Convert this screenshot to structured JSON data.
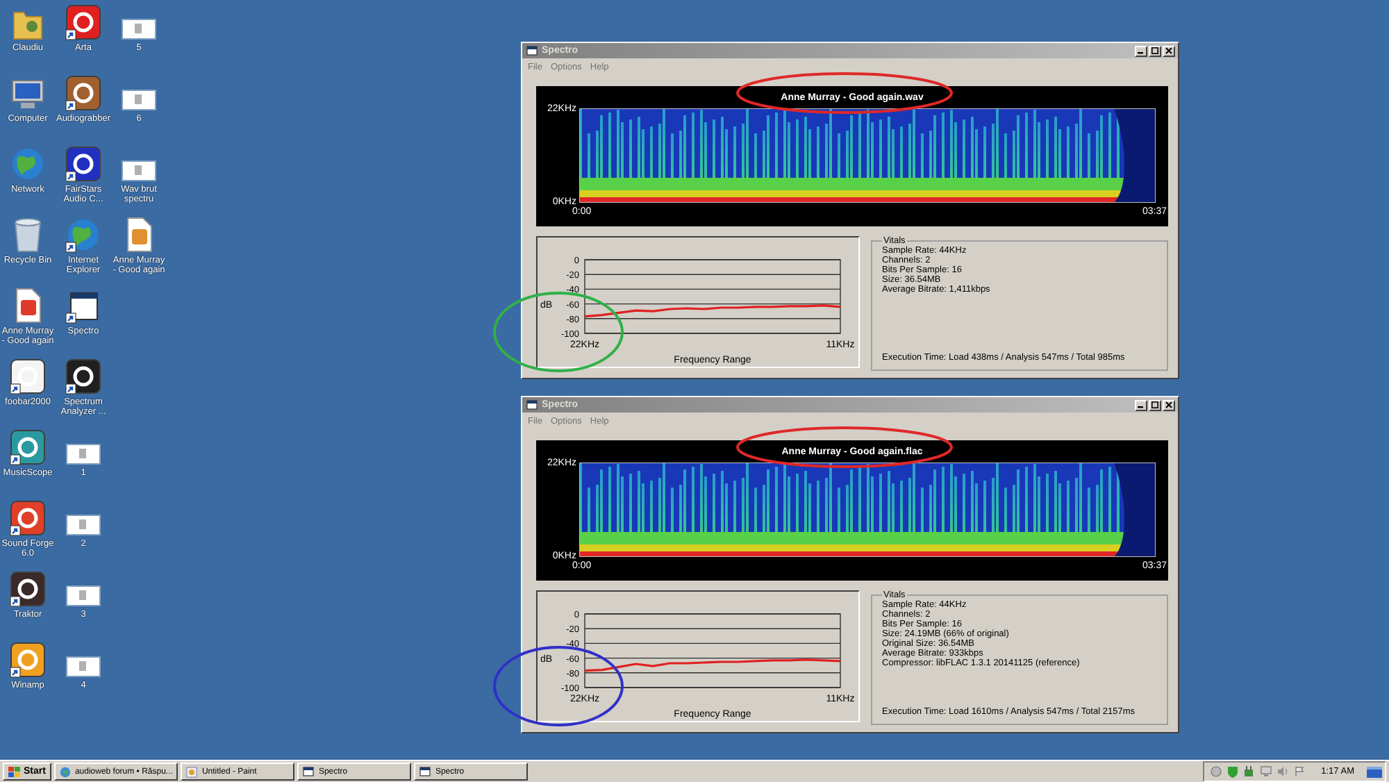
{
  "desktop_icons": [
    {
      "label": "Claudiu",
      "kind": "folder",
      "shortcut": false
    },
    {
      "label": "Computer",
      "kind": "computer",
      "shortcut": false
    },
    {
      "label": "Network",
      "kind": "globe",
      "shortcut": false
    },
    {
      "label": "Recycle Bin",
      "kind": "bin",
      "shortcut": false
    },
    {
      "label": "Anne Murray - Good again",
      "kind": "document",
      "color": "#e03a2a",
      "shortcut": false
    },
    {
      "label": "foobar2000",
      "kind": "app",
      "color": "#f4f4f4",
      "shortcut": true
    },
    {
      "label": "MusicScope",
      "kind": "app",
      "color": "#2a9aa0",
      "shortcut": true
    },
    {
      "label": "Sound Forge 6.0",
      "kind": "app",
      "color": "#e0402a",
      "shortcut": true
    },
    {
      "label": "Traktor",
      "kind": "app",
      "color": "#3a2a2a",
      "shortcut": true
    },
    {
      "label": "Winamp",
      "kind": "app",
      "color": "#f0a020",
      "shortcut": true
    },
    {
      "label": "Arta",
      "kind": "app",
      "color": "#e02020",
      "shortcut": true
    },
    {
      "label": "Audiograbber",
      "kind": "app",
      "color": "#a06030",
      "shortcut": true
    },
    {
      "label": "FairStars Audio C...",
      "kind": "app",
      "color": "#2030c0",
      "shortcut": true
    },
    {
      "label": "Internet Explorer",
      "kind": "globe",
      "shortcut": true
    },
    {
      "label": "Spectro",
      "kind": "window",
      "shortcut": true
    },
    {
      "label": "Spectrum Analyzer ...",
      "kind": "app",
      "color": "#202020",
      "shortcut": true
    },
    {
      "label": "1",
      "kind": "thumbnail",
      "shortcut": false
    },
    {
      "label": "2",
      "kind": "thumbnail",
      "shortcut": false
    },
    {
      "label": "3",
      "kind": "thumbnail",
      "shortcut": false
    },
    {
      "label": "4",
      "kind": "thumbnail",
      "shortcut": false
    },
    {
      "label": "5",
      "kind": "thumbnail",
      "shortcut": false
    },
    {
      "label": "6",
      "kind": "thumbnail",
      "shortcut": false
    },
    {
      "label": "Wav brut spectru",
      "kind": "thumbnail",
      "shortcut": false
    },
    {
      "label": "Anne Murray - Good again",
      "kind": "document",
      "color": "#e09030",
      "shortcut": false
    }
  ],
  "windows": [
    {
      "title": "Spectro",
      "menu": [
        "File",
        "Options",
        "Help"
      ],
      "spectrogram": {
        "title": "Anne Murray - Good again.wav",
        "y_top": "22KHz",
        "y_bottom": "0KHz",
        "start": "0:00",
        "end": "03:37"
      },
      "title_highlight": {
        "color": "#e02828"
      },
      "graph_highlight": {
        "color": "#30b048"
      },
      "chart_data": {
        "type": "line",
        "xlabel": "Frequency Range",
        "ylabel": "dB",
        "categories": [
          "22KHz",
          null,
          null,
          null,
          null,
          null,
          null,
          null,
          null,
          null,
          null,
          null,
          null,
          null,
          null,
          "11KHz"
        ],
        "series": [
          {
            "color": "#e02020",
            "values": [
              -77,
              -75,
              -72,
              -69,
              -70,
              -67,
              -66,
              -67,
              -65,
              -65,
              -64,
              -64,
              -63,
              -63,
              -62,
              -64
            ]
          }
        ],
        "grid": true,
        "ylim": [
          -100,
          0
        ],
        "yticks": [
          0,
          -20,
          -40,
          -60,
          -80,
          -100
        ]
      },
      "vitals": {
        "legend": "Vitals",
        "lines": [
          "Sample Rate: 44KHz",
          "Channels: 2",
          "Bits Per Sample: 16",
          "Size: 36.54MB",
          "Average Bitrate: 1,411kbps"
        ],
        "execution": "Execution Time: Load 438ms / Analysis 547ms / Total 985ms"
      }
    },
    {
      "title": "Spectro",
      "menu": [
        "File",
        "Options",
        "Help"
      ],
      "spectrogram": {
        "title": "Anne Murray - Good again.flac",
        "y_top": "22KHz",
        "y_bottom": "0KHz",
        "start": "0:00",
        "end": "03:37"
      },
      "title_highlight": {
        "color": "#e02828"
      },
      "graph_highlight": {
        "color": "#3030c8"
      },
      "chart_data": {
        "type": "line",
        "xlabel": "Frequency Range",
        "ylabel": "dB",
        "categories": [
          "22KHz",
          null,
          null,
          null,
          null,
          null,
          null,
          null,
          null,
          null,
          null,
          null,
          null,
          null,
          null,
          "11KHz"
        ],
        "series": [
          {
            "color": "#e02020",
            "values": [
              -77,
              -76,
              -72,
              -68,
              -71,
              -67,
              -67,
              -66,
              -65,
              -65,
              -64,
              -63,
              -63,
              -62,
              -63,
              -64
            ]
          }
        ],
        "grid": true,
        "ylim": [
          -100,
          0
        ],
        "yticks": [
          0,
          -20,
          -40,
          -60,
          -80,
          -100
        ]
      },
      "vitals": {
        "legend": "Vitals",
        "lines": [
          "Sample Rate: 44KHz",
          "Channels: 2",
          "Bits Per Sample: 16",
          "Size: 24.19MB (66% of original)",
          "Original Size: 36.54MB",
          "Average Bitrate: 933kbps",
          "Compressor: libFLAC 1.3.1 20141125 (reference)"
        ],
        "execution": "Execution Time: Load 1610ms / Analysis 547ms / Total 2157ms"
      }
    }
  ],
  "taskbar": {
    "start": "Start",
    "tasks": [
      {
        "label": "audioweb forum • Răspu...",
        "kind": "browser"
      },
      {
        "label": "Untitled - Paint",
        "kind": "paint"
      },
      {
        "label": "Spectro",
        "kind": "window"
      },
      {
        "label": "Spectro",
        "kind": "window"
      }
    ],
    "clock": "1:17 AM"
  }
}
